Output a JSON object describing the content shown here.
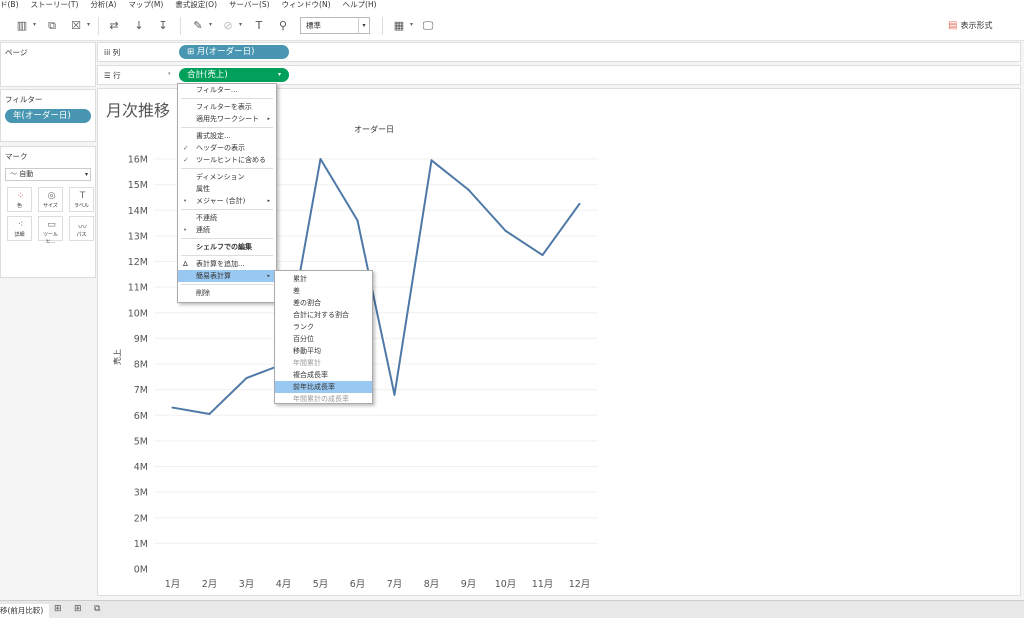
{
  "menubar": [
    "ド(B)",
    "ストーリー(T)",
    "分析(A)",
    "マップ(M)",
    "書式設定(O)",
    "サーバー(S)",
    "ウィンドウ(N)",
    "ヘルプ(H)"
  ],
  "toolbar": {
    "standard_select": "標準",
    "show_me": "表示形式"
  },
  "pages_title": "ページ",
  "filters": {
    "title": "フィルター",
    "pill": "年(オーダー日)"
  },
  "marks": {
    "title": "マーク",
    "type": "自動",
    "buttons": [
      "色",
      "サイズ",
      "ラベル",
      "詳細",
      "ツールヒ...",
      "パス"
    ]
  },
  "shelves": {
    "columns_label": "列",
    "columns_pill": "月(オーダー日)",
    "rows_label": "行",
    "rows_pill": "合計(売上)"
  },
  "sheet_title": "月次推移",
  "context_menu": {
    "items": [
      "フィルター...",
      "フィルターを表示",
      "適用先ワークシート",
      "書式設定...",
      "ヘッダーの表示",
      "ツールヒントに含める",
      "ディメンション",
      "属性",
      "メジャー (合計)",
      "不連続",
      "連続",
      "シェルフでの編集",
      "表計算を追加...",
      "簡易表計算",
      "削除"
    ]
  },
  "submenu": {
    "items": [
      "累計",
      "差",
      "差の割合",
      "合計に対する割合",
      "ランク",
      "百分位",
      "移動平均",
      "年間累計",
      "複合成長率",
      "前年比成長率",
      "年間累計の成長率"
    ]
  },
  "statusbar": {
    "sheet_tab": "移(前月比較)"
  },
  "chart_data": {
    "type": "line",
    "title": "オーダー日",
    "xlabel": "",
    "ylabel": "売上",
    "categories": [
      "1月",
      "2月",
      "3月",
      "4月",
      "5月",
      "6月",
      "7月",
      "8月",
      "9月",
      "10月",
      "11月",
      "12月"
    ],
    "y_tick_labels": [
      "0M",
      "1M",
      "2M",
      "3M",
      "4M",
      "5M",
      "6M",
      "7M",
      "8M",
      "9M",
      "10M",
      "11M",
      "12M",
      "13M",
      "14M",
      "15M",
      "16M"
    ],
    "values": [
      6.3,
      6.05,
      7.45,
      8.0,
      16.0,
      13.6,
      6.8,
      15.95,
      14.8,
      13.2,
      12.25,
      14.25
    ],
    "ylim": [
      0,
      16
    ],
    "grid": true,
    "line_color": "#4e79a7"
  }
}
